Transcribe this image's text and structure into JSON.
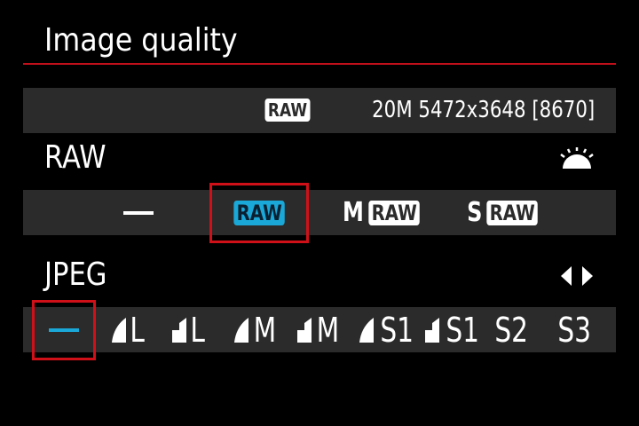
{
  "header": {
    "title": "Image quality"
  },
  "info_bar": {
    "raw_badge": "RAW",
    "details": "20M 5472x3648 [8670]"
  },
  "raw_section": {
    "label": "RAW",
    "control_icon": "main-dial-icon",
    "options": [
      {
        "id": "none",
        "prefix": "",
        "badge": "",
        "selected": false
      },
      {
        "id": "raw",
        "prefix": "",
        "badge": "RAW",
        "selected": true
      },
      {
        "id": "mraw",
        "prefix": "M",
        "badge": "RAW",
        "selected": false
      },
      {
        "id": "sraw",
        "prefix": "S",
        "badge": "RAW",
        "selected": false
      }
    ]
  },
  "jpeg_section": {
    "label": "JPEG",
    "control_icon": "left-right-arrows-icon",
    "options": [
      {
        "id": "none",
        "icon": "",
        "text": "",
        "selected": true
      },
      {
        "id": "L-fine",
        "icon": "fine-quality-icon",
        "text": "L",
        "selected": false
      },
      {
        "id": "L-normal",
        "icon": "normal-quality-icon",
        "text": "L",
        "selected": false
      },
      {
        "id": "M-fine",
        "icon": "fine-quality-icon",
        "text": "M",
        "selected": false
      },
      {
        "id": "M-normal",
        "icon": "normal-quality-icon",
        "text": "M",
        "selected": false
      },
      {
        "id": "S1-fine",
        "icon": "fine-quality-icon",
        "text": "S1",
        "selected": false
      },
      {
        "id": "S1-normal",
        "icon": "normal-quality-icon",
        "text": "S1",
        "selected": false
      },
      {
        "id": "S2",
        "icon": "",
        "text": "S2",
        "selected": false
      },
      {
        "id": "S3",
        "icon": "",
        "text": "S3",
        "selected": false
      }
    ]
  },
  "colors": {
    "accent_rule": "#c0101a",
    "selected_blue": "#1aa8d8",
    "selection_frame": "#d01018",
    "bar_bg": "#2b2b2b"
  }
}
